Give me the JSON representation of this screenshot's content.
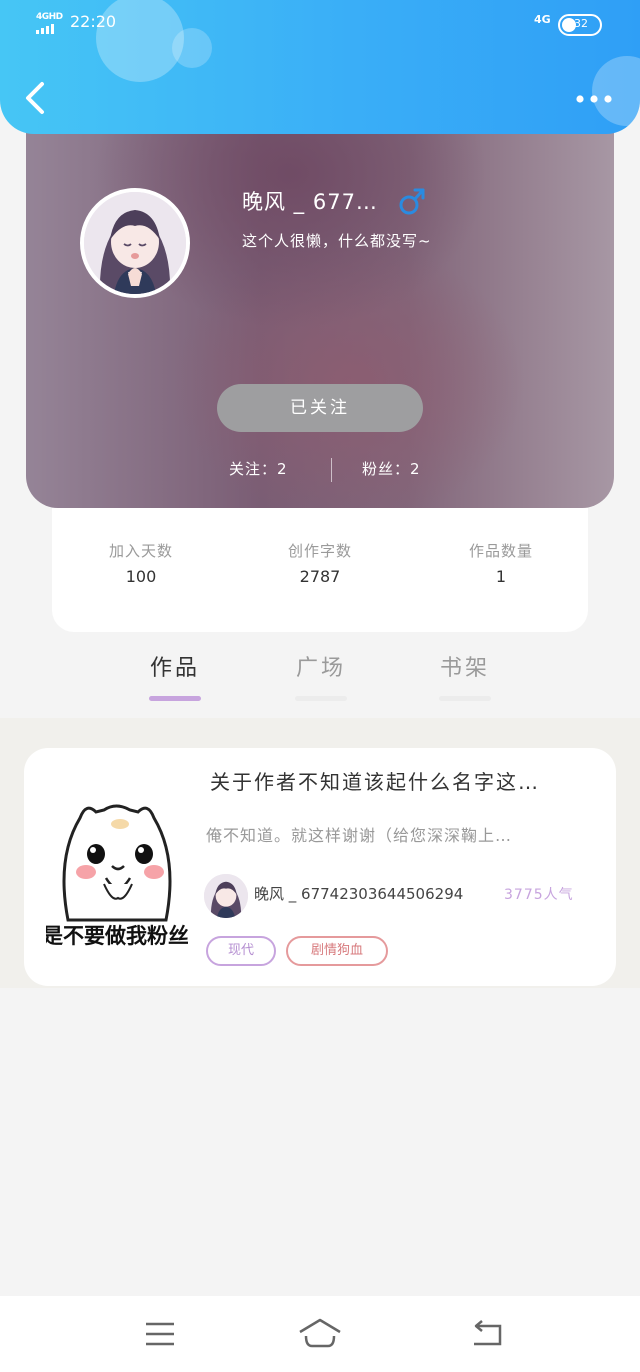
{
  "status_bar": {
    "network_left": "4GHD",
    "time": "22:20",
    "network_right": "4G",
    "battery": "32"
  },
  "profile": {
    "nickname": "晚风 _ 677…",
    "gender": "male",
    "gender_symbol": "♂",
    "bio": "这个人很懒，什么都没写~",
    "follow_button": "已关注",
    "following_label": "关注：",
    "following_count": "2",
    "fans_label": "粉丝：",
    "fans_count": "2"
  },
  "stats": [
    {
      "label": "加入天数",
      "value": "100"
    },
    {
      "label": "创作字数",
      "value": "2787"
    },
    {
      "label": "作品数量",
      "value": "1"
    }
  ],
  "tabs": [
    {
      "label": "作品",
      "active": true
    },
    {
      "label": "广场",
      "active": false
    },
    {
      "label": "书架",
      "active": false
    }
  ],
  "works": [
    {
      "title": "关于作者不知道该起什么名字这…",
      "description": "俺不知道。就这样谢谢（给您深深鞠上…",
      "cover_caption": "是不要做我粉丝",
      "author": "晚风 _ 67742303644506294",
      "popularity": "3775人气",
      "tags": [
        "现代",
        "剧情狗血"
      ]
    }
  ],
  "colors": {
    "header_gradient_start": "#46c6f5",
    "header_gradient_end": "#2f9ff6",
    "accent_purple": "#c7a4de",
    "tag_red": "#e59a9c",
    "gender_blue": "#2a8be0"
  },
  "icons": {
    "back": "chevron-left-icon",
    "more": "more-dots-icon",
    "gender": "male-symbol-icon",
    "nav": [
      "menu-icon",
      "home-icon",
      "back-arrow-icon"
    ]
  }
}
